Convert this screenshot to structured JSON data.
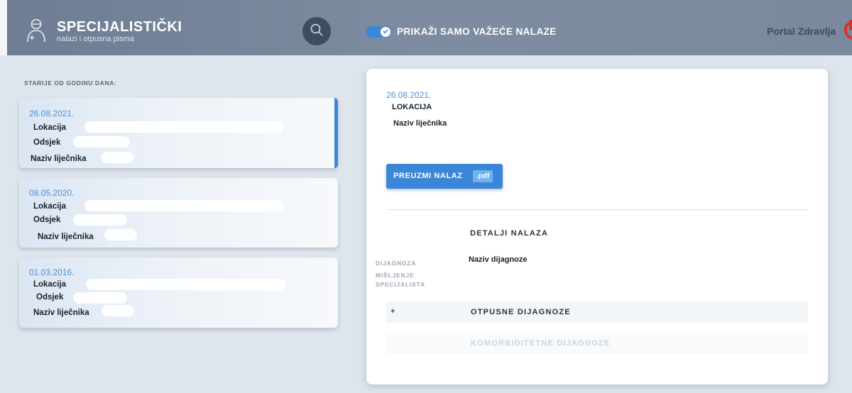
{
  "header": {
    "brand_title": "SPECIJALISTIČKI",
    "brand_subtitle": "nalazi i otpusna pisma",
    "toggle_label": "PRIKAŽI SAMO VAŽEĆE NALAZE",
    "toggle_on": true,
    "portal_label": "Portal Zdravlja",
    "icons": [
      "doctor-icon",
      "search-icon",
      "check-icon",
      "logout-icon"
    ]
  },
  "list": {
    "heading": "STARIJE OD GODINU DANA:",
    "items": [
      {
        "date": "26.08.2021.",
        "location": "Lokacija",
        "department": "Odsjek",
        "doctor": "Naziv liječnika",
        "active": true
      },
      {
        "date": "08.05.2020.",
        "location": "Lokacija",
        "department": "Odsjek",
        "doctor": "Naziv liječnika",
        "active": false
      },
      {
        "date": "01.03.2016.",
        "location": "Lokacija",
        "department": "Odsjek",
        "doctor": "Naziv liječnika",
        "active": false
      }
    ]
  },
  "detail": {
    "date": "26.08.2021.",
    "location": "LOKACIJA",
    "doctor": "Naziv liječnika",
    "download_label": "PREUZMI NALAZ",
    "download_format": ".pdf",
    "section_title": "DETALJI NALAZA",
    "diagnosis_label": "DIJAGNOZA",
    "diagnosis_value": "Naziv dijagnoze",
    "opinion_label_1": "MIŠLJENJE",
    "opinion_label_2": "SPECIJALISTA",
    "accordion_plus": "+",
    "discharge_title": "OTPUSNE DIJAGNOZE",
    "comorbid_title": "KOMORBIDITETNE DIJAGNOZE"
  },
  "colors": {
    "accent": "#3b86d6",
    "date_blue": "#4e8fd4",
    "header_bg": "#7e8ca1",
    "portal_red": "#d9302a"
  }
}
